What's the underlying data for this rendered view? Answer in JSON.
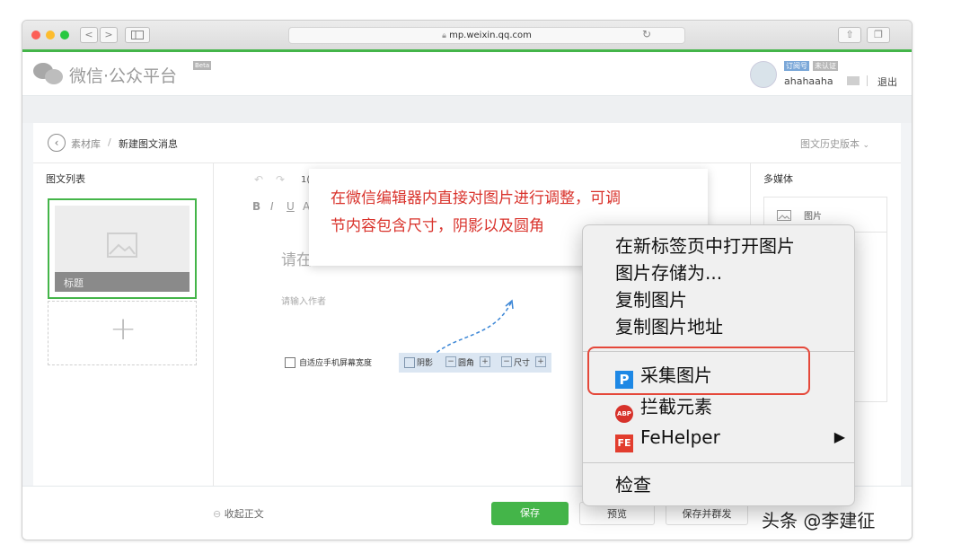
{
  "browser": {
    "url": "mp.weixin.qq.com",
    "nav_back": "<",
    "nav_forward": ">"
  },
  "header": {
    "logo_text": "微信·公众平台",
    "beta": "Beta",
    "badge_subscribe": "订阅号",
    "badge_unverified": "未认证",
    "username": "ahahaaha",
    "logout": "退出"
  },
  "breadcrumb": {
    "parent": "素材库",
    "separator": "/",
    "current": "新建图文消息",
    "history": "图文历史版本"
  },
  "left": {
    "title": "图文列表",
    "card_title": "标题",
    "add": "+"
  },
  "editor": {
    "title_placeholder": "请在",
    "author_placeholder": "请输入作者",
    "fit_width": "自适应手机屏幕宽度",
    "shadow": "阴影",
    "radius": "圆角",
    "size": "尺寸",
    "toolbar_letters": [
      "B",
      "I",
      "U",
      "A"
    ],
    "toolbar_num": "1("
  },
  "right": {
    "title": "多媒体",
    "image": "图片"
  },
  "bottom": {
    "collapse": "收起正文",
    "save": "保存",
    "preview": "预览",
    "save_send": "保存并群发"
  },
  "annotation": {
    "line1": "在微信编辑器内直接对图片进行调整，可调",
    "line2": "节内容包含尺寸，阴影以及圆角"
  },
  "context_menu": {
    "items": [
      "在新标签页中打开图片",
      "图片存储为...",
      "复制图片",
      "复制图片地址"
    ],
    "collect": "采集图片",
    "collect_icon": "P",
    "block": "拦截元素",
    "block_icon": "ABP",
    "fehelper": "FeHelper",
    "fehelper_icon": "FE",
    "arrow": "▶",
    "inspect": "检查"
  },
  "watermark": "头条 @李建征",
  "colors": {
    "brand_green": "#44b549",
    "highlight_red": "#e5483a",
    "annotation_red": "#d9322b"
  }
}
